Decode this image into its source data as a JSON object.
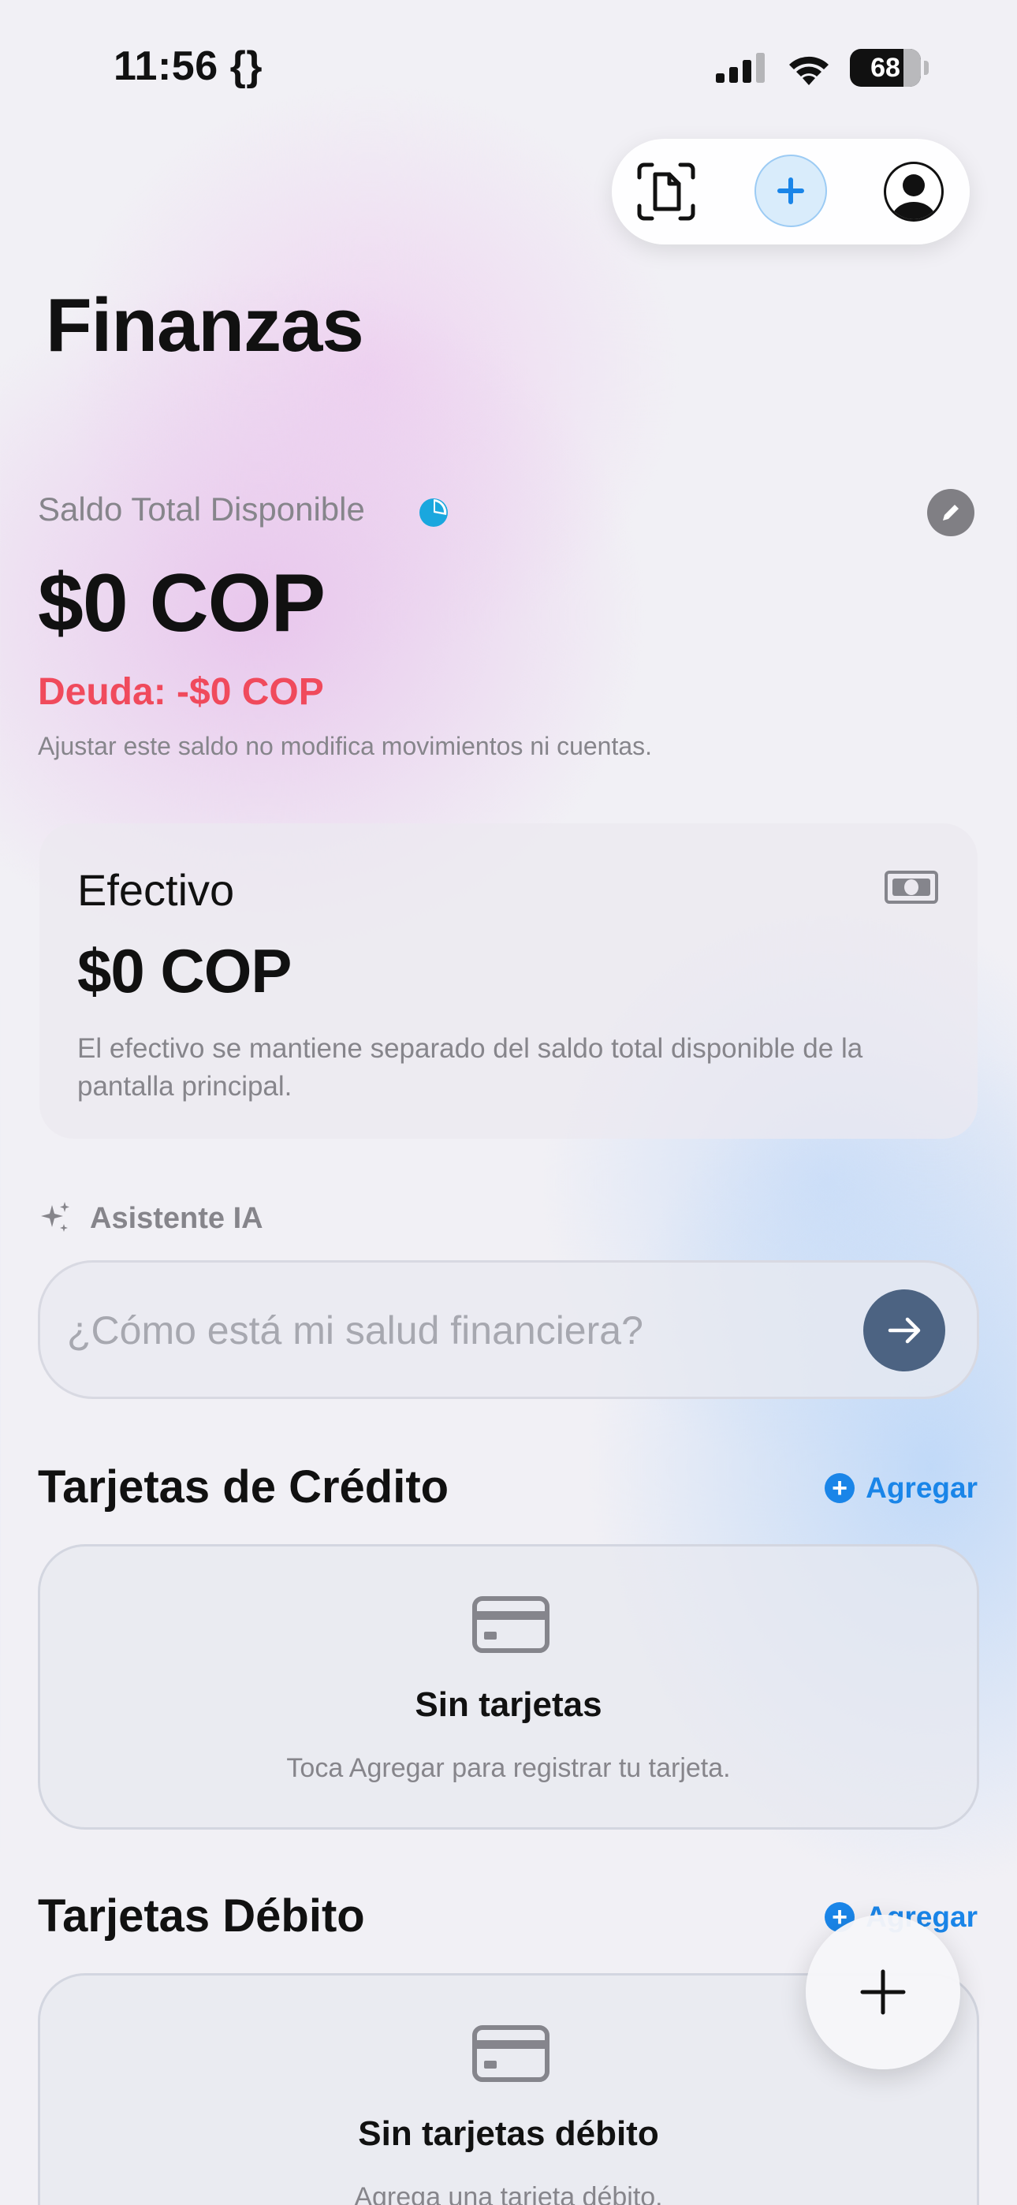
{
  "status_bar": {
    "time": "11:56 {}",
    "battery": "68"
  },
  "top_toolbar": {
    "icons": [
      "doc-scan-icon",
      "plus-icon",
      "profile-icon"
    ],
    "accent": "#1a85e8"
  },
  "page": {
    "title": "Finanzas"
  },
  "balance": {
    "label": "Saldo Total Disponible",
    "amount": "$0 COP",
    "debt": "Deuda: -$0 COP",
    "note": "Ajustar este saldo no modifica movimientos ni cuentas.",
    "debt_color": "#f04a5c"
  },
  "cash_card": {
    "title": "Efectivo",
    "amount": "$0 COP",
    "note": "El efectivo se mantiene separado del saldo total disponible de la pantalla principal."
  },
  "assistant": {
    "label": "Asistente IA",
    "placeholder": "¿Cómo está mi salud financiera?"
  },
  "credit_cards": {
    "title": "Tarjetas de Crédito",
    "add_label": "Agregar",
    "empty_title": "Sin tarjetas",
    "empty_subtitle": "Toca Agregar para registrar tu tarjeta."
  },
  "debit_cards": {
    "title": "Tarjetas Débito",
    "add_label": "Agregar",
    "empty_title": "Sin tarjetas débito",
    "empty_subtitle": "Agrega una tarjeta débito."
  }
}
